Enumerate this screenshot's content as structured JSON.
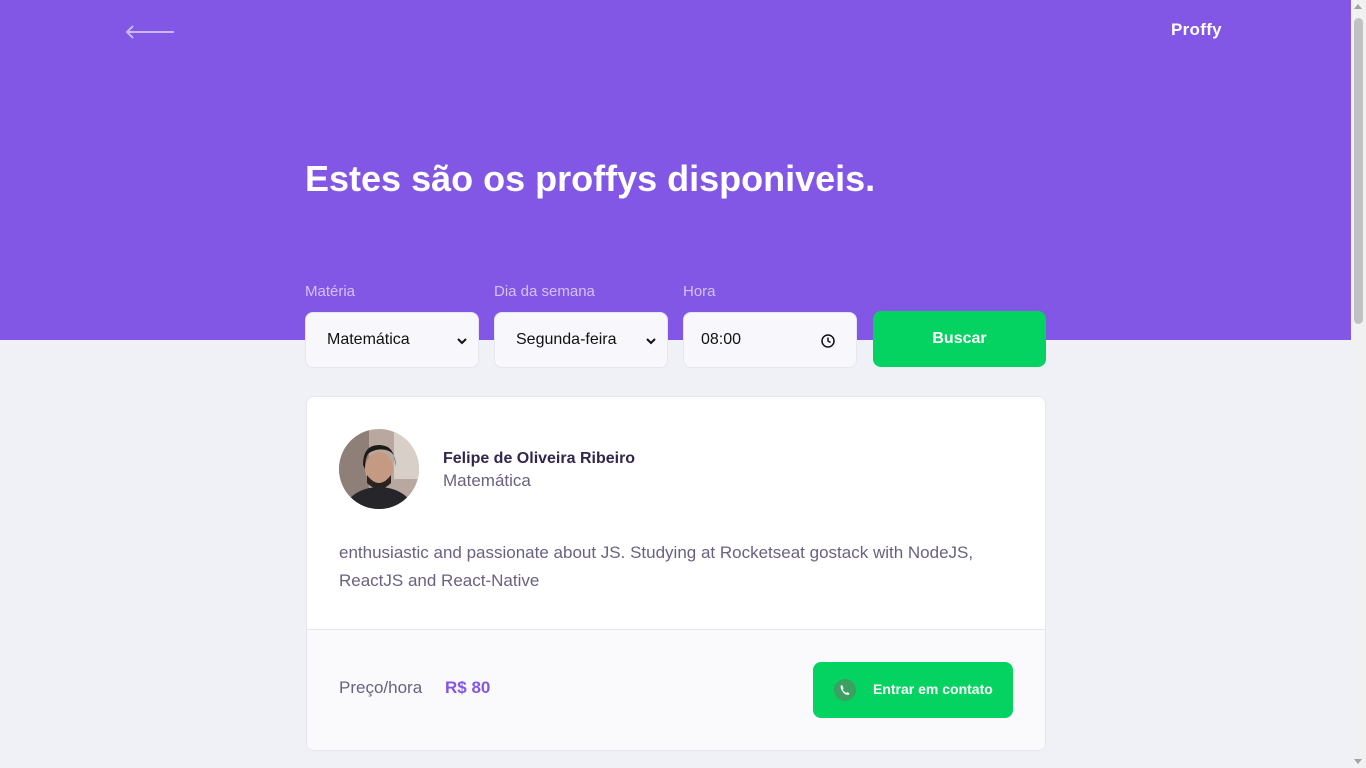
{
  "header": {
    "logo": "Proffy",
    "back_icon": "arrow-left-icon",
    "title": "Estes são os proffys disponiveis."
  },
  "filters": {
    "subject": {
      "label": "Matéria",
      "value": "Matemática"
    },
    "week_day": {
      "label": "Dia da semana",
      "value": "Segunda-feira"
    },
    "time": {
      "label": "Hora",
      "value": "08:00"
    },
    "submit_label": "Buscar"
  },
  "teacher": {
    "name": "Felipe de Oliveira Ribeiro",
    "subject": "Matemática",
    "bio": "enthusiastic and passionate about JS. Studying at Rocketseat gostack with NodeJS, ReactJS and React-Native",
    "price_label": "Preço/hora",
    "price_value": "R$ 80",
    "contact_label": "Entrar em contato",
    "contact_icon": "whatsapp-icon"
  },
  "colors": {
    "primary": "#8257E5",
    "secondary": "#04D361",
    "background": "#F0F0F7",
    "text_title": "#32264D",
    "text_base": "#6A6180",
    "label_light": "#D4C2FF"
  }
}
